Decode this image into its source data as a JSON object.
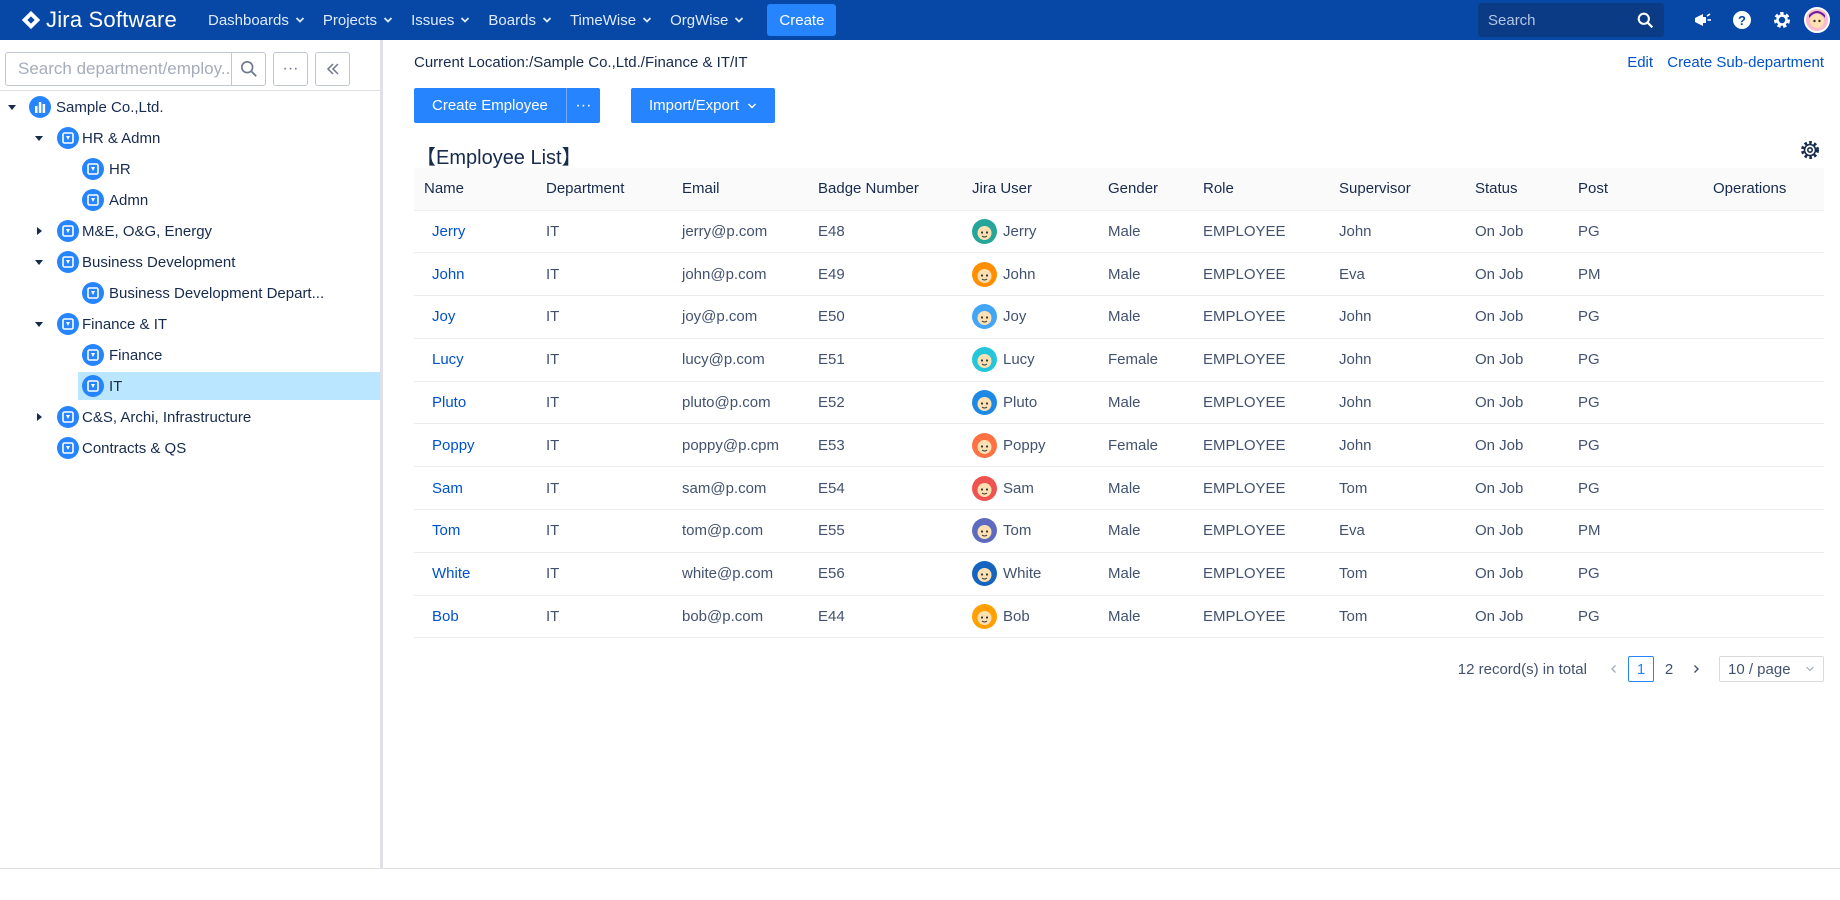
{
  "nav": {
    "logo": "Jira Software",
    "items": [
      "Dashboards",
      "Projects",
      "Issues",
      "Boards",
      "TimeWise",
      "OrgWise"
    ],
    "create_label": "Create",
    "search_placeholder": "Search"
  },
  "sidebar": {
    "search_placeholder": "Search department/employ...",
    "more_label": "···",
    "tree": [
      {
        "label": "Sample Co.,Ltd.",
        "level": 0,
        "caret": "down",
        "root": true
      },
      {
        "label": "HR & Admn",
        "level": 1,
        "caret": "down"
      },
      {
        "label": "HR",
        "level": 2,
        "caret": ""
      },
      {
        "label": "Admn",
        "level": 2,
        "caret": ""
      },
      {
        "label": "M&E, O&G, Energy",
        "level": 1,
        "caret": "right"
      },
      {
        "label": "Business Development",
        "level": 1,
        "caret": "down"
      },
      {
        "label": "Business Development Depart...",
        "level": 2,
        "caret": ""
      },
      {
        "label": "Finance & IT",
        "level": 1,
        "caret": "down"
      },
      {
        "label": "Finance",
        "level": 2,
        "caret": ""
      },
      {
        "label": "IT",
        "level": 2,
        "caret": "",
        "selected": true
      },
      {
        "label": "C&S, Archi, Infrastructure",
        "level": 1,
        "caret": "right"
      },
      {
        "label": "Contracts & QS",
        "level": 1,
        "caret": ""
      }
    ]
  },
  "main": {
    "location": "Current Location:/Sample Co.,Ltd./Finance & IT/IT",
    "edit_label": "Edit",
    "create_sub_label": "Create Sub-department",
    "create_employee_label": "Create Employee",
    "more_label": "···",
    "import_export_label": "Import/Export",
    "list_title": "【Employee List】",
    "columns": [
      "Name",
      "Department",
      "Email",
      "Badge Number",
      "Jira User",
      "Gender",
      "Role",
      "Supervisor",
      "Status",
      "Post",
      "Operations"
    ],
    "rows": [
      {
        "name": "Jerry",
        "dept": "IT",
        "email": "jerry@p.com",
        "badge": "E48",
        "user": "Jerry",
        "gender": "Male",
        "role": "EMPLOYEE",
        "supervisor": "John",
        "status": "On Job",
        "post": "PG",
        "avatar_color": "#26a69a"
      },
      {
        "name": "John",
        "dept": "IT",
        "email": "john@p.com",
        "badge": "E49",
        "user": "John",
        "gender": "Male",
        "role": "EMPLOYEE",
        "supervisor": "Eva",
        "status": "On Job",
        "post": "PM",
        "avatar_color": "#ff8f00"
      },
      {
        "name": "Joy",
        "dept": "IT",
        "email": "joy@p.com",
        "badge": "E50",
        "user": "Joy",
        "gender": "Male",
        "role": "EMPLOYEE",
        "supervisor": "John",
        "status": "On Job",
        "post": "PG",
        "avatar_color": "#42a5f5"
      },
      {
        "name": "Lucy",
        "dept": "IT",
        "email": "lucy@p.com",
        "badge": "E51",
        "user": "Lucy",
        "gender": "Female",
        "role": "EMPLOYEE",
        "supervisor": "John",
        "status": "On Job",
        "post": "PG",
        "avatar_color": "#26c6da"
      },
      {
        "name": "Pluto",
        "dept": "IT",
        "email": "pluto@p.com",
        "badge": "E52",
        "user": "Pluto",
        "gender": "Male",
        "role": "EMPLOYEE",
        "supervisor": "John",
        "status": "On Job",
        "post": "PG",
        "avatar_color": "#1e88e5"
      },
      {
        "name": "Poppy",
        "dept": "IT",
        "email": "poppy@p.cpm",
        "badge": "E53",
        "user": "Poppy",
        "gender": "Female",
        "role": "EMPLOYEE",
        "supervisor": "John",
        "status": "On Job",
        "post": "PG",
        "avatar_color": "#ff7043"
      },
      {
        "name": "Sam",
        "dept": "IT",
        "email": "sam@p.com",
        "badge": "E54",
        "user": "Sam",
        "gender": "Male",
        "role": "EMPLOYEE",
        "supervisor": "Tom",
        "status": "On Job",
        "post": "PG",
        "avatar_color": "#ef5350"
      },
      {
        "name": "Tom",
        "dept": "IT",
        "email": "tom@p.com",
        "badge": "E55",
        "user": "Tom",
        "gender": "Male",
        "role": "EMPLOYEE",
        "supervisor": "Eva",
        "status": "On Job",
        "post": "PM",
        "avatar_color": "#5c6bc0"
      },
      {
        "name": "White",
        "dept": "IT",
        "email": "white@p.com",
        "badge": "E56",
        "user": "White",
        "gender": "Male",
        "role": "EMPLOYEE",
        "supervisor": "Tom",
        "status": "On Job",
        "post": "PG",
        "avatar_color": "#1565c0"
      },
      {
        "name": "Bob",
        "dept": "IT",
        "email": "bob@p.com",
        "badge": "E44",
        "user": "Bob",
        "gender": "Male",
        "role": "EMPLOYEE",
        "supervisor": "Tom",
        "status": "On Job",
        "post": "PG",
        "avatar_color": "#ffa000"
      }
    ],
    "pagination": {
      "total_text": "12 record(s) in total",
      "pages": [
        "1",
        "2"
      ],
      "current": "1",
      "page_size": "10 / page"
    }
  },
  "colors": {
    "nav_bg": "#0747a6",
    "accent": "#2684ff",
    "link": "#0052cc",
    "selected_bg": "#bae7ff"
  }
}
